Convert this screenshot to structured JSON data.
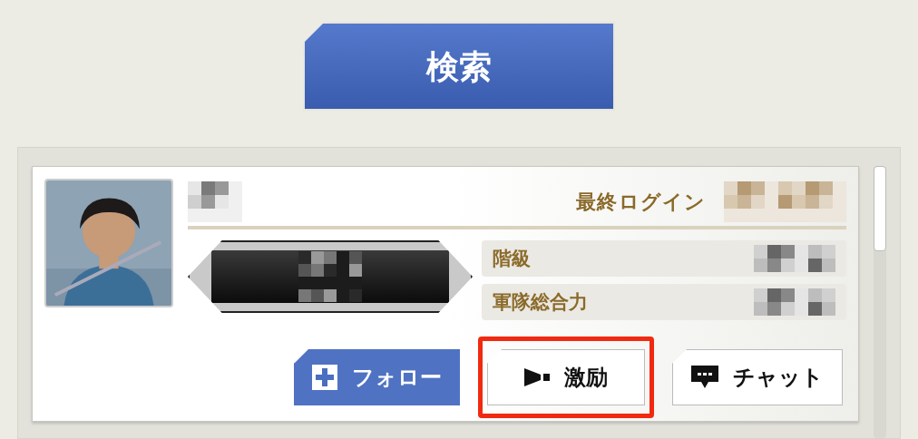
{
  "header": {
    "search_button": "検索"
  },
  "profile": {
    "last_login_label": "最終ログイン",
    "stats": [
      {
        "label": "階級"
      },
      {
        "label": "軍隊総合力"
      }
    ]
  },
  "buttons": [
    {
      "kind": "follow",
      "label": "フォロー",
      "highlighted": false
    },
    {
      "kind": "cheer",
      "label": "激励",
      "highlighted": true
    },
    {
      "kind": "chat",
      "label": "チャット",
      "highlighted": false
    }
  ]
}
